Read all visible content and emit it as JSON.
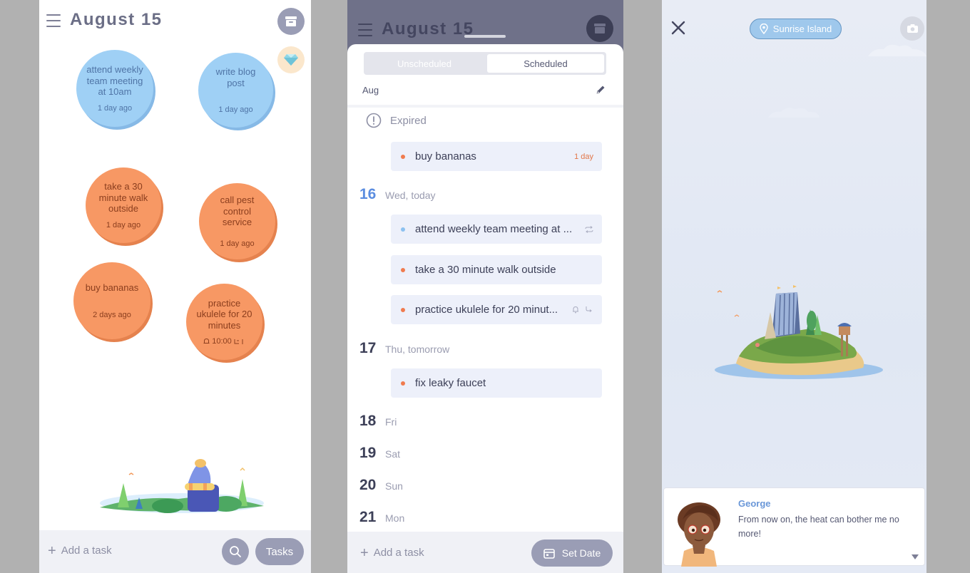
{
  "panel1": {
    "title": "August 15",
    "tasks": [
      {
        "text": "attend weekly team meeting at 10am",
        "meta": "1 day ago",
        "color": "#9fd0f5"
      },
      {
        "text": "write blog post",
        "meta": "1 day ago",
        "color": "#9fd0f5"
      },
      {
        "text": "take a 30 minute walk outside",
        "meta": "1 day ago",
        "color": "#f79864"
      },
      {
        "text": "call pest control service",
        "meta": "1 day ago",
        "color": "#f79864"
      },
      {
        "text": "buy bananas",
        "meta": "2 days ago",
        "color": "#f79864"
      },
      {
        "text": "practice ukulele for 20 minutes",
        "meta": "10:00",
        "color": "#f79864"
      }
    ],
    "add_task": "Add a task",
    "tasks_button": "Tasks",
    "icons": [
      "menu-icon",
      "archive-icon",
      "diamond-icon",
      "search-icon",
      "plus-icon",
      "bell-icon",
      "repeat-icon"
    ]
  },
  "panel2": {
    "title": "August 15",
    "tabs": {
      "unscheduled": "Unscheduled",
      "scheduled": "Scheduled"
    },
    "month": "Aug",
    "expired": {
      "label": "Expired",
      "tasks": [
        {
          "text": "buy bananas",
          "meta": "1 day",
          "dot": "#f07b4e"
        }
      ]
    },
    "days": [
      {
        "num": "16",
        "name": "Wed, today",
        "tasks": [
          {
            "text": "attend weekly team meeting at ...",
            "dot": "#8cc1f0"
          },
          {
            "text": "take a 30 minute walk outside",
            "dot": "#f07b4e"
          },
          {
            "text": "practice ukulele for 20 minut...",
            "dot": "#f07b4e"
          }
        ]
      },
      {
        "num": "17",
        "name": "Thu, tomorrow",
        "tasks": [
          {
            "text": "fix leaky faucet",
            "dot": "#f07b4e"
          }
        ]
      },
      {
        "num": "18",
        "name": "Fri"
      },
      {
        "num": "19",
        "name": "Sat"
      },
      {
        "num": "20",
        "name": "Sun"
      },
      {
        "num": "21",
        "name": "Mon"
      }
    ],
    "add_task": "Add a task",
    "set_date": "Set Date"
  },
  "panel3": {
    "location": "Sunrise Island",
    "speaker": "George",
    "message": "From now on, the heat can bother me no more!"
  },
  "colors": {
    "accent": "#9a9db5",
    "today": "#5b8de0",
    "orange": "#f79864",
    "blue": "#9fd0f5"
  }
}
